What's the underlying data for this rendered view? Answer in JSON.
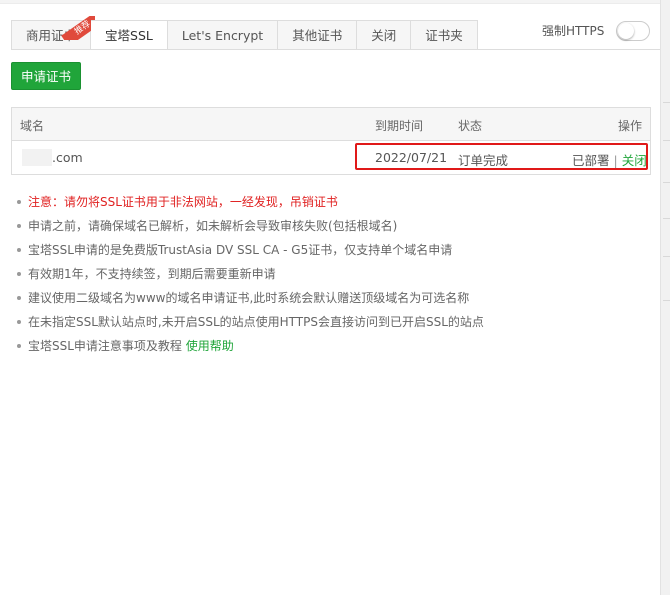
{
  "tabs": [
    {
      "label": "商用证书",
      "badge": "推荐"
    },
    {
      "label": "宝塔SSL"
    },
    {
      "label": "Let's Encrypt"
    },
    {
      "label": "其他证书"
    },
    {
      "label": "关闭"
    },
    {
      "label": "证书夹"
    }
  ],
  "active_tab": "宝塔SSL",
  "https": {
    "label": "强制HTTPS",
    "enabled": false
  },
  "apply_button": "申请证书",
  "table": {
    "headers": {
      "domain": "域名",
      "expire": "到期时间",
      "status": "状态",
      "action": "操作"
    },
    "rows": [
      {
        "domain": ".com",
        "expire": "2022/07/21",
        "status": "订单完成",
        "deployed": "已部署",
        "separator": "|",
        "close": "关闭"
      }
    ]
  },
  "notes": [
    "注意：请勿将SSL证书用于非法网站，一经发现，吊销证书",
    "申请之前，请确保域名已解析，如未解析会导致审核失败(包括根域名)",
    "宝塔SSL申请的是免费版TrustAsia DV SSL CA - G5证书，仅支持单个域名申请",
    "有效期1年，不支持续签，到期后需要重新申请",
    "建议使用二级域名为www的域名申请证书,此时系统会默认赠送顶级域名为可选名称",
    "在未指定SSL默认站点时,未开启SSL的站点使用HTTPS会直接访问到已开启SSL的站点",
    "宝塔SSL申请注意事项及教程"
  ],
  "help_link": "使用帮助",
  "colors": {
    "accent": "#20a53a",
    "warning": "#e02222",
    "highlight": "#e01919",
    "badge": "#e04a3c"
  }
}
